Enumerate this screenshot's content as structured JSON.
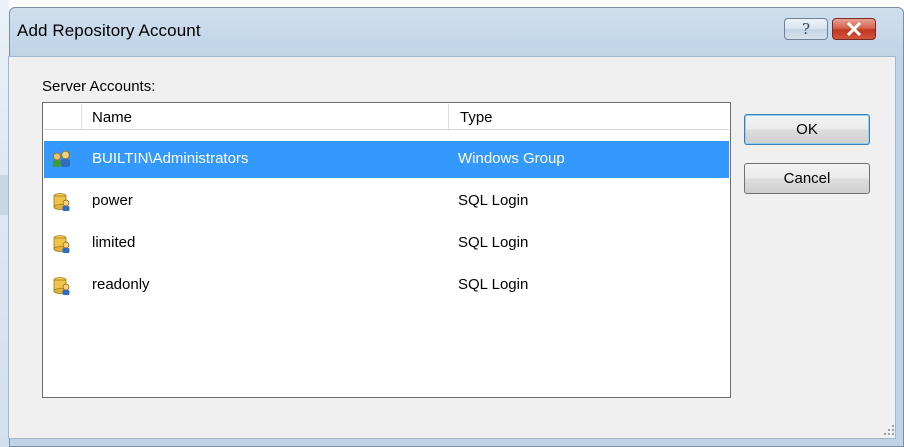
{
  "dialog": {
    "title": "Add Repository Account",
    "help_glyph": "?",
    "close_icon": "close-icon"
  },
  "accounts_label": "Server Accounts:",
  "list": {
    "columns": {
      "name": "Name",
      "type": "Type"
    },
    "rows": [
      {
        "name": "BUILTIN\\Administrators",
        "type": "Windows Group",
        "icon": "users-group-icon",
        "selected": true
      },
      {
        "name": "power",
        "type": "SQL Login",
        "icon": "database-user-icon",
        "selected": false
      },
      {
        "name": "limited",
        "type": "SQL Login",
        "icon": "database-user-icon",
        "selected": false
      },
      {
        "name": "readonly",
        "type": "SQL Login",
        "icon": "database-user-icon",
        "selected": false
      }
    ]
  },
  "buttons": {
    "ok": "OK",
    "cancel": "Cancel"
  },
  "colors": {
    "selection": "#3399ff",
    "title_bar": "#c4d7ea",
    "close_button": "#c0371f"
  }
}
